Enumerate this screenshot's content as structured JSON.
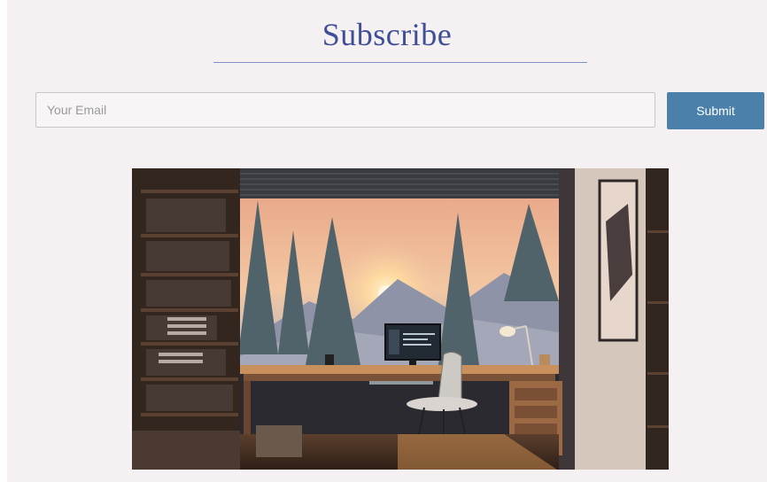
{
  "subscribe": {
    "title": "Subscribe",
    "email_placeholder": "Your Email",
    "email_value": "",
    "submit_label": "Submit"
  },
  "colors": {
    "title": "#3f4f97",
    "rule": "#7f90c4",
    "button": "#4b80ab",
    "page_background": "#f5f0f1"
  },
  "hero_image": {
    "description_icon": "lofi-study-room-illustration"
  }
}
